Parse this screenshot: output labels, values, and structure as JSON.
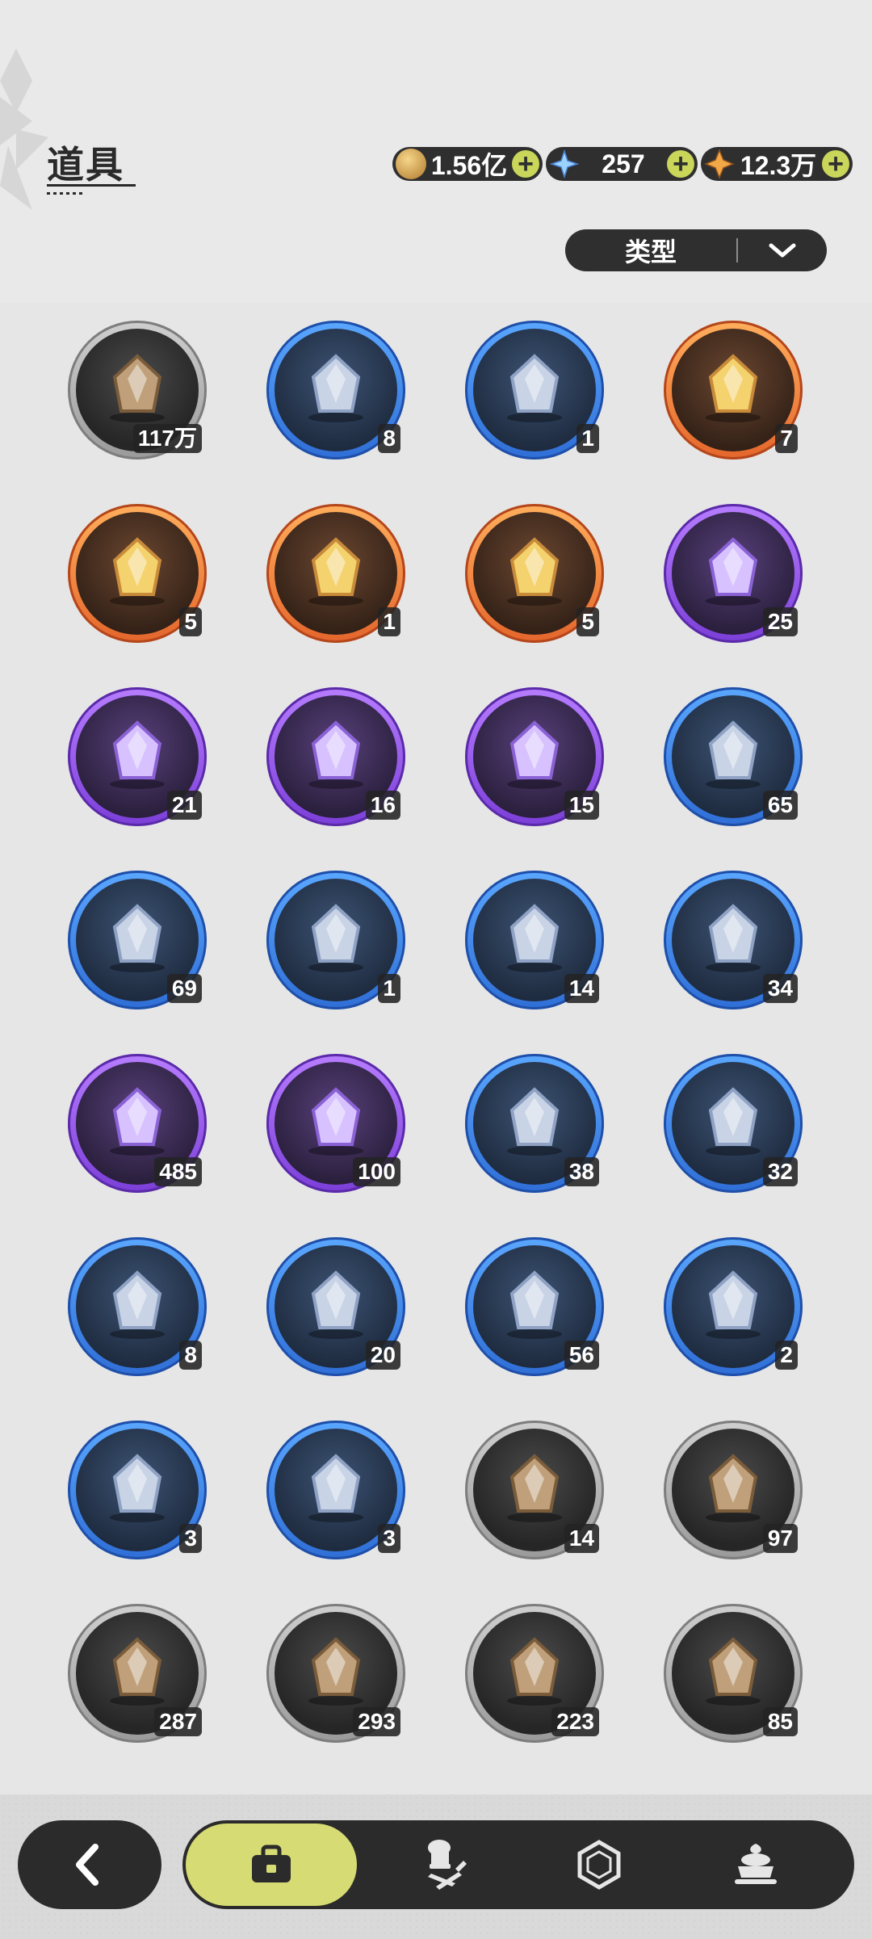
{
  "header": {
    "title": "道具"
  },
  "currencies": [
    {
      "name": "mora",
      "value": "1.56亿",
      "icon": "gold-coin-icon",
      "color": "#c89a4a"
    },
    {
      "name": "crystal",
      "value": "257",
      "icon": "crystal-icon",
      "color": "#7ec3ff"
    },
    {
      "name": "star",
      "value": "12.3万",
      "icon": "star-crystal-icon",
      "color": "#f0a240"
    }
  ],
  "filter": {
    "label": "类型"
  },
  "items": [
    {
      "name": "pet-food-bag",
      "count": "117万",
      "rarity": "gray"
    },
    {
      "name": "feather-bundle",
      "count": "8",
      "rarity": "blue"
    },
    {
      "name": "potion-vial",
      "count": "1",
      "rarity": "blue"
    },
    {
      "name": "pocket-watch",
      "count": "7",
      "rarity": "orange"
    },
    {
      "name": "green-potion",
      "count": "5",
      "rarity": "orange"
    },
    {
      "name": "blue-book",
      "count": "1",
      "rarity": "orange"
    },
    {
      "name": "golden-book",
      "count": "5",
      "rarity": "orange"
    },
    {
      "name": "quill-ink",
      "count": "25",
      "rarity": "purple"
    },
    {
      "name": "pillow",
      "count": "21",
      "rarity": "purple"
    },
    {
      "name": "orange-book",
      "count": "16",
      "rarity": "purple"
    },
    {
      "name": "sword-book",
      "count": "15",
      "rarity": "purple"
    },
    {
      "name": "towel",
      "count": "65",
      "rarity": "blue"
    },
    {
      "name": "teacup",
      "count": "69",
      "rarity": "blue"
    },
    {
      "name": "golden-leaf",
      "count": "1",
      "rarity": "blue"
    },
    {
      "name": "card-book",
      "count": "14",
      "rarity": "blue"
    },
    {
      "name": "forest-book",
      "count": "34",
      "rarity": "blue"
    },
    {
      "name": "purple-ore",
      "count": "485",
      "rarity": "purple"
    },
    {
      "name": "purple-crystal-shards",
      "count": "100",
      "rarity": "purple"
    },
    {
      "name": "purple-orb",
      "count": "38",
      "rarity": "blue"
    },
    {
      "name": "winged-gem",
      "count": "32",
      "rarity": "blue"
    },
    {
      "name": "rune-stone",
      "count": "8",
      "rarity": "blue"
    },
    {
      "name": "blue-feather",
      "count": "20",
      "rarity": "blue"
    },
    {
      "name": "ice-branch",
      "count": "56",
      "rarity": "blue"
    },
    {
      "name": "amber-orb",
      "count": "2",
      "rarity": "blue"
    },
    {
      "name": "wind-sigil",
      "count": "3",
      "rarity": "blue"
    },
    {
      "name": "red-crystal-ring",
      "count": "3",
      "rarity": "blue"
    },
    {
      "name": "void-orb",
      "count": "14",
      "rarity": "gray"
    },
    {
      "name": "snowball",
      "count": "97",
      "rarity": "gray"
    },
    {
      "name": "ice-crystals",
      "count": "287",
      "rarity": "gray"
    },
    {
      "name": "lava-rock",
      "count": "293",
      "rarity": "gray"
    },
    {
      "name": "fire-shard",
      "count": "223",
      "rarity": "gray"
    },
    {
      "name": "screw",
      "count": "85",
      "rarity": "gray"
    }
  ],
  "nav": {
    "back_icon": "back-arrow-icon",
    "tabs": [
      {
        "icon": "bag-icon",
        "active": true
      },
      {
        "icon": "chef-hat-icon",
        "active": false
      },
      {
        "icon": "hexagon-icon",
        "active": false
      },
      {
        "icon": "dessert-icon",
        "active": false
      }
    ]
  }
}
